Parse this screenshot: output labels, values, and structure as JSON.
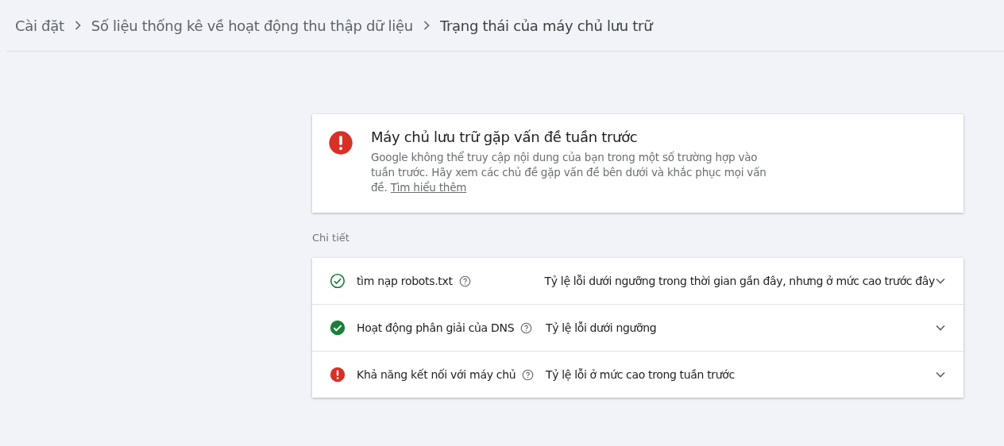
{
  "breadcrumb": [
    {
      "label": "Cài đặt",
      "current": false
    },
    {
      "label": "Số liệu thống kê về hoạt động thu thập dữ liệu",
      "current": false
    },
    {
      "label": "Trạng thái của máy chủ lưu trữ",
      "current": true
    }
  ],
  "alert": {
    "kind": "error",
    "title": "Máy chủ lưu trữ gặp vấn đề tuần trước",
    "message": "Google không thể truy cập nội dung của bạn trong một số trường hợp vào tuần trước. Hãy xem các chủ đề gặp vấn đề bên dưới và khắc phục mọi vấn đề.",
    "link": "Tìm hiểu thêm"
  },
  "details_heading": "Chi tiết",
  "details": [
    {
      "kind": "ok-past",
      "name": "tìm nạp robots.txt",
      "status": "Tỷ lệ lỗi dưới ngưỡng trong thời gian gần đây, nhưng ở mức cao trước đây",
      "expanded": false
    },
    {
      "kind": "ok",
      "name": "Hoạt động phân giải của DNS",
      "status": "Tỷ lệ lỗi dưới ngưỡng",
      "expanded": false
    },
    {
      "kind": "error",
      "name": "Khả năng kết nối với máy chủ",
      "status": "Tỷ lệ lỗi ở mức cao trong tuần trước",
      "expanded": false
    }
  ]
}
